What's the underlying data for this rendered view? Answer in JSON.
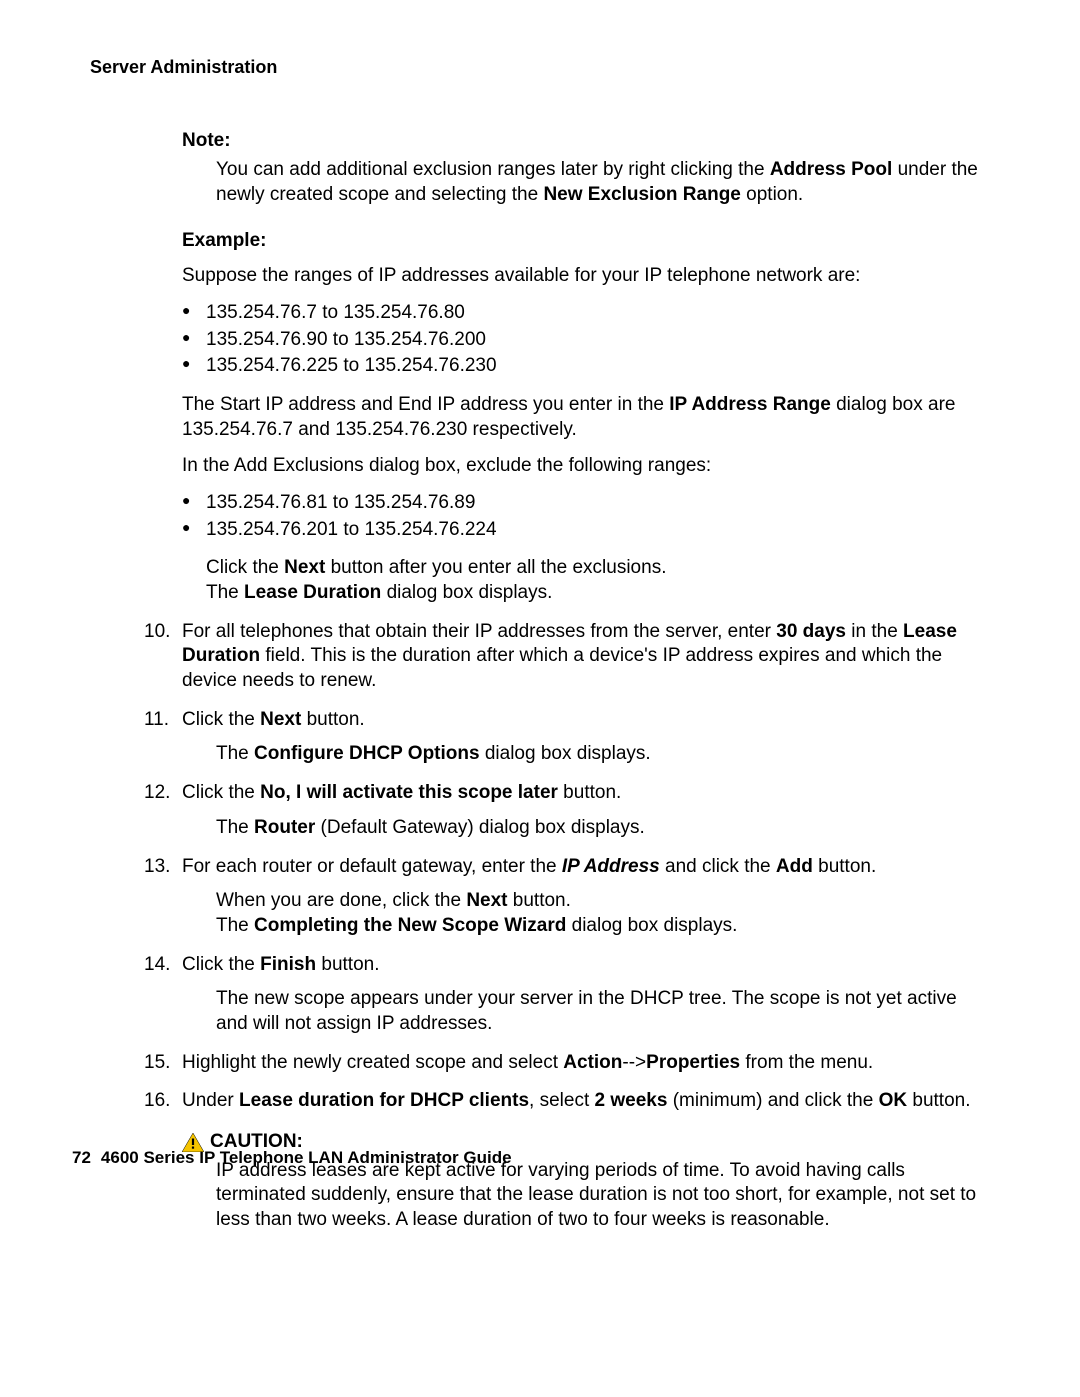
{
  "sectionHeader": "Server Administration",
  "note": {
    "label": "Note:",
    "body_pre": "You can add additional exclusion ranges later by right clicking the ",
    "body_b1": "Address Pool",
    "body_mid": " under the newly created scope and selecting the ",
    "body_b2": "New Exclusion Range",
    "body_post": " option."
  },
  "example": {
    "label": "Example:",
    "intro": "Suppose the ranges of IP addresses available for your IP telephone network are:",
    "ranges": [
      "135.254.76.7 to 135.254.76.80",
      "135.254.76.90 to 135.254.76.200",
      "135.254.76.225 to 135.254.76.230"
    ],
    "startend_pre": "The Start IP address and End IP address you enter in the ",
    "startend_b": "IP Address Range",
    "startend_post": " dialog box are 135.254.76.7 and 135.254.76.230 respectively.",
    "exclude_intro": "In the Add Exclusions dialog box, exclude the following ranges:",
    "exclude_ranges": [
      "135.254.76.81 to 135.254.76.89",
      "135.254.76.201 to 135.254.76.224"
    ],
    "afterex_l1a": "Click the ",
    "afterex_l1b": "Next",
    "afterex_l1c": " button after you enter all the exclusions.",
    "afterex_l2a": "The ",
    "afterex_l2b": "Lease Duration",
    "afterex_l2c": " dialog box displays."
  },
  "steps": {
    "s10": {
      "num": "10.",
      "a": "For all telephones that obtain their IP addresses from the server, enter ",
      "b1": "30 days",
      "c": " in the ",
      "b2": "Lease Duration",
      "d": " field. This is the duration after which a device's IP address expires and which the device needs to renew."
    },
    "s11": {
      "num": "11.",
      "a": "Click the ",
      "b": "Next",
      "c": " button.",
      "sub_a": "The ",
      "sub_b": "Configure DHCP Options",
      "sub_c": " dialog box displays."
    },
    "s12": {
      "num": "12.",
      "a": "Click the ",
      "b": "No, I will activate this scope later",
      "c": " button.",
      "sub_a": "The ",
      "sub_b": "Router",
      "sub_c": " (Default Gateway) dialog box displays."
    },
    "s13": {
      "num": "13.",
      "a": "For each router or default gateway, enter the ",
      "b1": "IP Address",
      "c": " and click the ",
      "b2": "Add",
      "d": " button.",
      "sub_l1a": "When you are done, click the ",
      "sub_l1b": "Next",
      "sub_l1c": " button.",
      "sub_l2a": "The ",
      "sub_l2b": "Completing the New Scope Wizard",
      "sub_l2c": " dialog box displays."
    },
    "s14": {
      "num": "14.",
      "a": "Click the ",
      "b": "Finish",
      "c": " button.",
      "sub": "The new scope appears under your server in the DHCP tree. The scope is not yet active and will not assign IP addresses."
    },
    "s15": {
      "num": "15.",
      "a": "Highlight the newly created scope and select ",
      "b1": "Action",
      "c": "-->",
      "b2": "Properties",
      "d": " from the menu."
    },
    "s16": {
      "num": "16.",
      "a": "Under ",
      "b1": "Lease duration for DHCP clients",
      "c": ", select ",
      "b2": "2 weeks",
      "d": " (minimum) and click the ",
      "b3": "OK",
      "e": " button."
    }
  },
  "caution": {
    "label": "CAUTION:",
    "body": "IP address leases are kept active for varying periods of time. To avoid having calls terminated suddenly, ensure that the lease duration is not too short, for example, not set to less than two weeks. A lease duration of two to four weeks is reasonable."
  },
  "footer": {
    "pageNum": "72",
    "title": "4600 Series IP Telephone LAN Administrator Guide"
  }
}
